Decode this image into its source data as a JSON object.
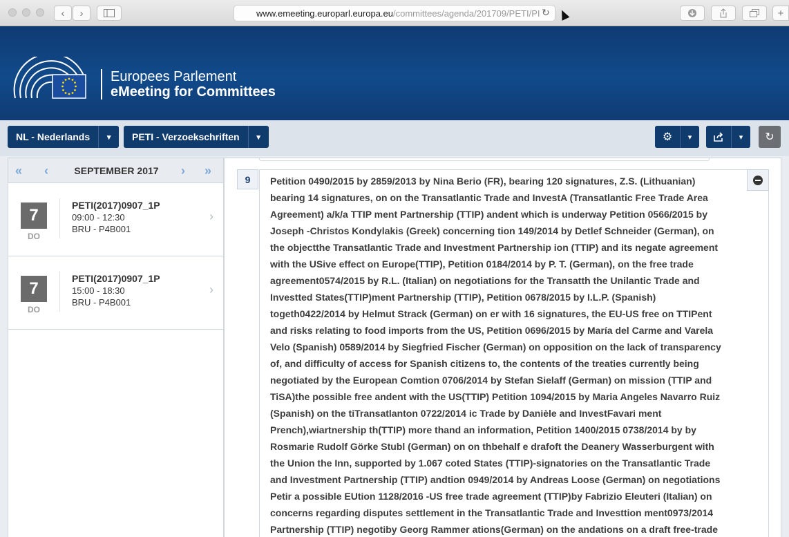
{
  "browser": {
    "url_main": "www.emeeting.europarl.europa.eu",
    "url_path": "/committees/agenda/201709/PETI/PI",
    "back_icon": "chevron-left-icon",
    "forward_icon": "chevron-right-icon"
  },
  "header": {
    "org_name": "Europees Parlement",
    "app_name": "eMeeting for Committees"
  },
  "toolbar": {
    "language": "NL - Nederlands",
    "committee": "PETI - Verzoekschriften",
    "caret": "▾"
  },
  "calendar": {
    "month": "SEPTEMBER 2017",
    "meetings": [
      {
        "day": "7",
        "weekday": "DO",
        "code": "PETI(2017)0907_1P",
        "time": "09:00 - 12:30",
        "room": "BRU - P4B001"
      },
      {
        "day": "7",
        "weekday": "DO",
        "code": "PETI(2017)0907_1P",
        "time": "15:00 - 18:30",
        "room": "BRU - P4B001"
      }
    ]
  },
  "agenda_item": {
    "number": "9",
    "text": "Petition 0490/2015 by 2859/2013 by Nina Berio (FR), bearing 120 signatures, Z.S. (Lithuanian) bearing 14 signatures, on on the Transatlantic Trade and InvestA (Transatlantic Free Trade Area Agreement) a/k/a TTIP ment Partnership (TTIP) andent which is underway Petition 0566/2015 by Joseph -Christos Kondylakis (Greek) concerning tion 149/2014 by Detlef Schneider (German), on the objectthe Transatlantic Trade and Investment Partnership ion (TTIP) and its negate agreement with the USive effect on Europe(TTIP), Petition 0184/2014 by P. T. (German), on the free trade agreement0574/2015 by R.L. (Italian) on negotiations for the Transatth the Unilantic Trade and Investted States(TTIP)ment Partnership (TTIP), Petition 0678/2015 by I.L.P. (Spanish) togeth0422/2014 by Helmut Strack (German) on er with 16 signatures, the EU-US free on TTIPent and risks relating to food imports from the US, Petition 0696/2015 by María del Carme and Varela Velo (Spanish) 0589/2014 by Siegfried Fischer (German) on opposition on the lack of transparency of, and difficulty of access for Spanish citizens to, the contents of the treaties currently being negotiated by the European Comtion 0706/2014 by Stefan Sielaff (German) on mission (TTIP and TiSA)the possible free andent with the US(TTIP) Petition 1094/2015 by Maria Angeles Navarro Ruiz (Spanish) on the tiTransatlanton 0722/2014 ic Trade by Danièle and InvestFavari ment Prench),wiartnership th(TTIP) more thand an information, Petition 1400/2015 0738/2014 by by Rosmarie Rudolf Görke Stubl (German) on on thbehalf e drafoft the Deanery Wasserburgent with the Union the Inn, supported by 1.067 coted States (TTIP)-signatories on the Transatlantic Trade and Investment Partnership (TTIP) andtion 0949/2014 by Andreas Loose (German) on negotiations Petir a possible EUtion 1128/2016 -US free trade agreement (TTIP)by Fabrizio Eleuteri (Italian) on concerns regarding disputes settlement in the Transatlantic Trade and Investtion ment0973/2014 Partnership (TTIP) negotiby Georg Rammer ations(German) on the andations on a draft free-trade"
  }
}
